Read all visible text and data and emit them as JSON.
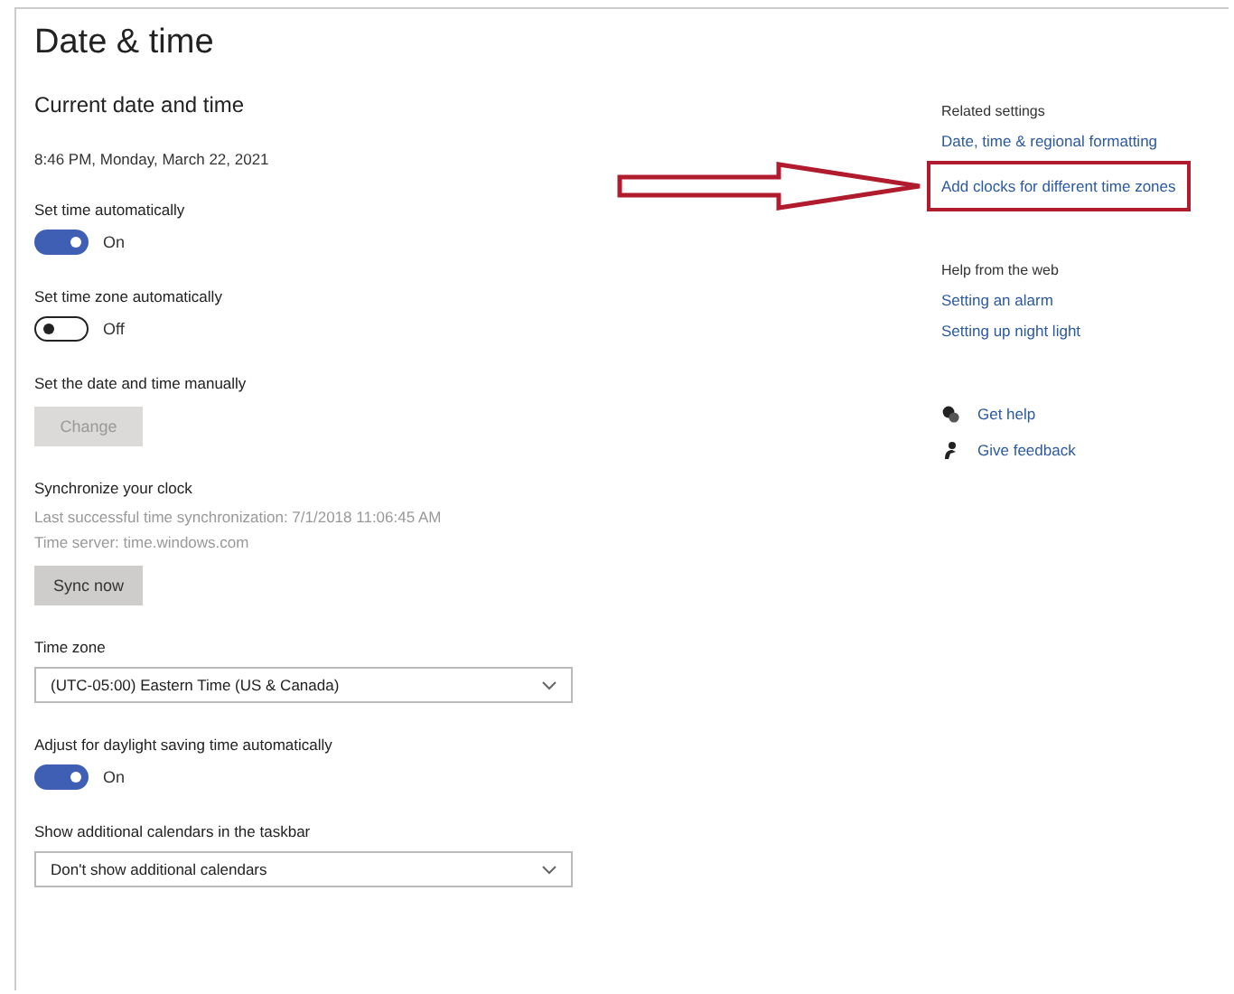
{
  "title": "Date & time",
  "section": "Current date and time",
  "current_time": "8:46 PM, Monday, March 22, 2021",
  "settings": [
    {
      "kind": "toggle",
      "label": "Set time automatically",
      "on": true,
      "state_text": "On"
    },
    {
      "kind": "toggle",
      "label": "Set time zone automatically",
      "on": false,
      "state_text": "Off"
    },
    {
      "kind": "button",
      "label": "Set the date and time manually",
      "button": "Change",
      "disabled": true
    },
    {
      "kind": "sync",
      "label": "Synchronize your clock",
      "lines": [
        "Last successful time synchronization: 7/1/2018 11:06:45 AM",
        "Time server: time.windows.com"
      ],
      "button": "Sync now",
      "disabled": false
    },
    {
      "kind": "dropdown",
      "label": "Time zone",
      "value": "(UTC-05:00) Eastern Time (US & Canada)"
    },
    {
      "kind": "toggle",
      "label": "Adjust for daylight saving time automatically",
      "on": true,
      "state_text": "On"
    },
    {
      "kind": "dropdown",
      "label": "Show additional calendars in the taskbar",
      "value": "Don't show additional calendars"
    }
  ],
  "related_settings": {
    "heading": "Related settings",
    "links": [
      {
        "label": "Date, time & regional formatting",
        "highlighted": false
      },
      {
        "label": "Add clocks for different time zones",
        "highlighted": true
      }
    ]
  },
  "help": {
    "heading": "Help from the web",
    "links": [
      {
        "label": "Setting an alarm"
      },
      {
        "label": "Setting up night light"
      }
    ]
  },
  "actions": [
    {
      "kind": "help",
      "label": "Get help"
    },
    {
      "kind": "feedback",
      "label": "Give feedback"
    }
  ]
}
